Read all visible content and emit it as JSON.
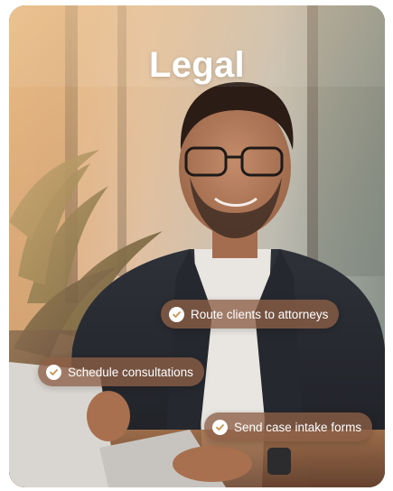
{
  "card": {
    "title": "Legal"
  },
  "features": [
    {
      "label": "Route clients to attorneys",
      "icon": "check-icon"
    },
    {
      "label": "Schedule consultations",
      "icon": "check-icon"
    },
    {
      "label": "Send case intake forms",
      "icon": "check-icon"
    }
  ],
  "colors": {
    "pill_background": "#8D5F46",
    "title_text": "#FFFFFF",
    "check_circle": "#FFFFFF",
    "check_mark": "#C9934E"
  }
}
